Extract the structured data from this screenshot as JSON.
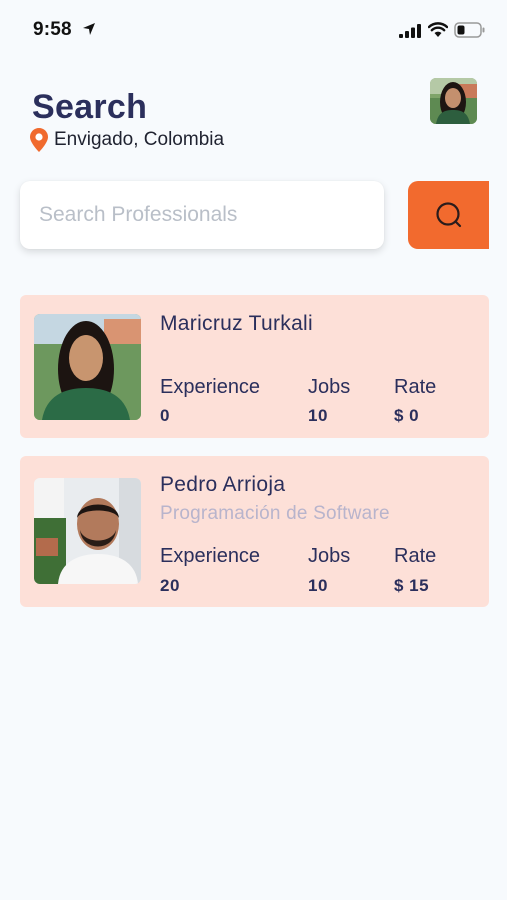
{
  "status_bar": {
    "time": "9:58"
  },
  "header": {
    "title": "Search",
    "location": "Envigado, Colombia"
  },
  "search": {
    "placeholder": "Search Professionals"
  },
  "stat_labels": {
    "experience": "Experience",
    "jobs": "Jobs",
    "rate": "Rate"
  },
  "professionals": [
    {
      "name": "Maricruz Turkali",
      "subtitle": "",
      "experience": "0",
      "jobs": "10",
      "rate": "$ 0"
    },
    {
      "name": "Pedro Arrioja",
      "subtitle": "Programación de Software",
      "experience": "20",
      "jobs": "10",
      "rate": "$ 15"
    }
  ],
  "colors": {
    "accent": "#f26a2e",
    "card_background": "#fde0d8",
    "title": "#2b2f5c",
    "page_background": "#f7fafd"
  },
  "icons": [
    "location-arrow-icon",
    "signal-icon",
    "wifi-icon",
    "battery-icon",
    "map-pin-icon",
    "search-icon"
  ]
}
